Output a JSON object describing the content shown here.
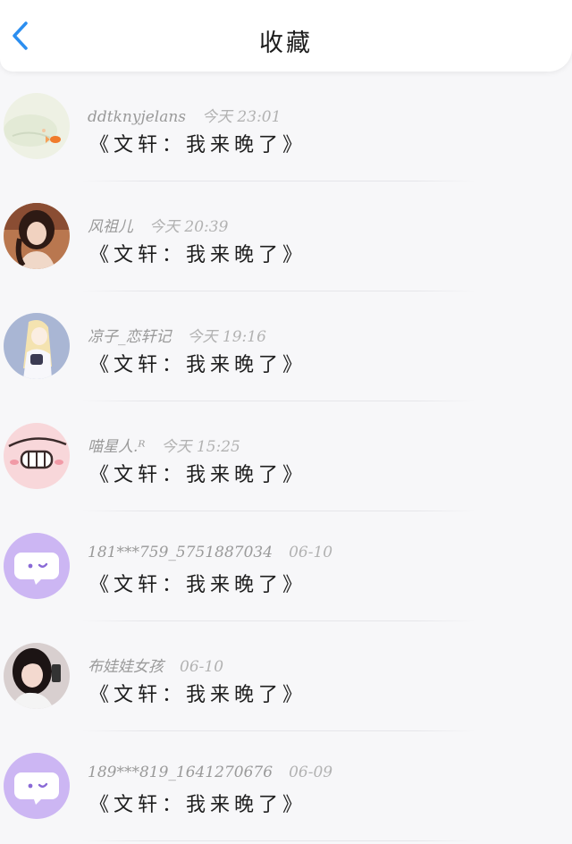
{
  "header": {
    "title": "收藏"
  },
  "colors": {
    "accent": "#2b8ef0",
    "background": "#f7f7f9",
    "meta_text": "#9a9a9a"
  },
  "items": [
    {
      "username": "ddtknyjelans",
      "time": "今天 23:01",
      "content": "《文轩：我来晚了》",
      "avatar": "avatar-fish-painting"
    },
    {
      "username": "风祖儿",
      "time": "今天 20:39",
      "content": "《文轩：我来晚了》",
      "avatar": "avatar-girl-photo"
    },
    {
      "username": "凉子_恋轩记",
      "time": "今天 19:16",
      "content": "《文轩：我来晚了》",
      "avatar": "avatar-anime-girl"
    },
    {
      "username": "喵星人.ᴿ",
      "time": "今天 15:25",
      "content": "《文轩：我来晚了》",
      "avatar": "avatar-pink-smile"
    },
    {
      "username": "181***759_5751887034",
      "time": "06-10",
      "content": "《文轩：我来晚了》",
      "avatar": "avatar-default-chat"
    },
    {
      "username": "布娃娃女孩",
      "time": "06-10",
      "content": "《文轩：我来晚了》",
      "avatar": "avatar-girl-selfie"
    },
    {
      "username": "189***819_1641270676",
      "time": "06-09",
      "content": "《文轩：我来晚了》",
      "avatar": "avatar-default-chat"
    }
  ]
}
